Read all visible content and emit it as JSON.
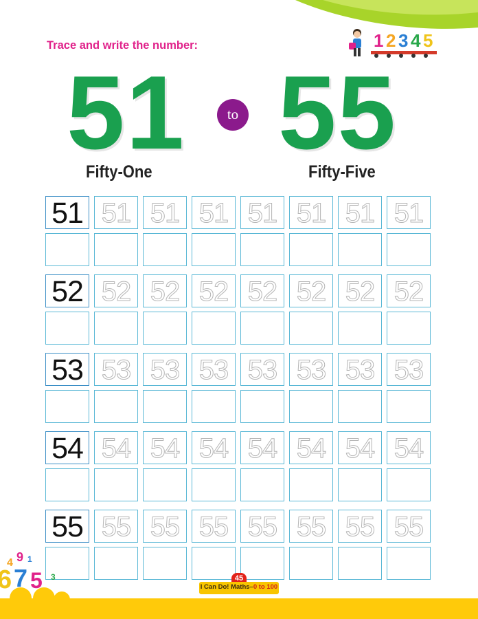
{
  "instruction": "Trace and write the number:",
  "decor": {
    "train_numbers": [
      "1",
      "2",
      "3",
      "4",
      "5"
    ],
    "train_colors": [
      "#e0218a",
      "#f5a623",
      "#2a7fd4",
      "#29a84a",
      "#f0c419"
    ],
    "corner_numbers": [
      "4",
      "9",
      "1",
      "6",
      "7",
      "5",
      "3"
    ]
  },
  "heading": {
    "start_number": "51",
    "connector": "to",
    "end_number": "55",
    "start_word": "Fifty-One",
    "end_word": "Fifty-Five"
  },
  "rows": [
    {
      "model": "51",
      "trace": [
        "51",
        "51",
        "51",
        "51",
        "51",
        "51",
        "51"
      ]
    },
    {
      "model": "52",
      "trace": [
        "52",
        "52",
        "52",
        "52",
        "52",
        "52",
        "52"
      ]
    },
    {
      "model": "53",
      "trace": [
        "53",
        "53",
        "53",
        "53",
        "53",
        "53",
        "53"
      ]
    },
    {
      "model": "54",
      "trace": [
        "54",
        "54",
        "54",
        "54",
        "54",
        "54",
        "54"
      ]
    },
    {
      "model": "55",
      "trace": [
        "55",
        "55",
        "55",
        "55",
        "55",
        "55",
        "55"
      ]
    }
  ],
  "footer": {
    "page_number": "45",
    "book_title": "I Can Do! Maths–",
    "book_range": "0 to 100"
  },
  "colors": {
    "accent_pink": "#e0218a",
    "number_green": "#1aa04f",
    "badge_purple": "#8b1a8c",
    "grid_blue": "#5ab8d6",
    "footer_yellow": "#ffca0a"
  }
}
